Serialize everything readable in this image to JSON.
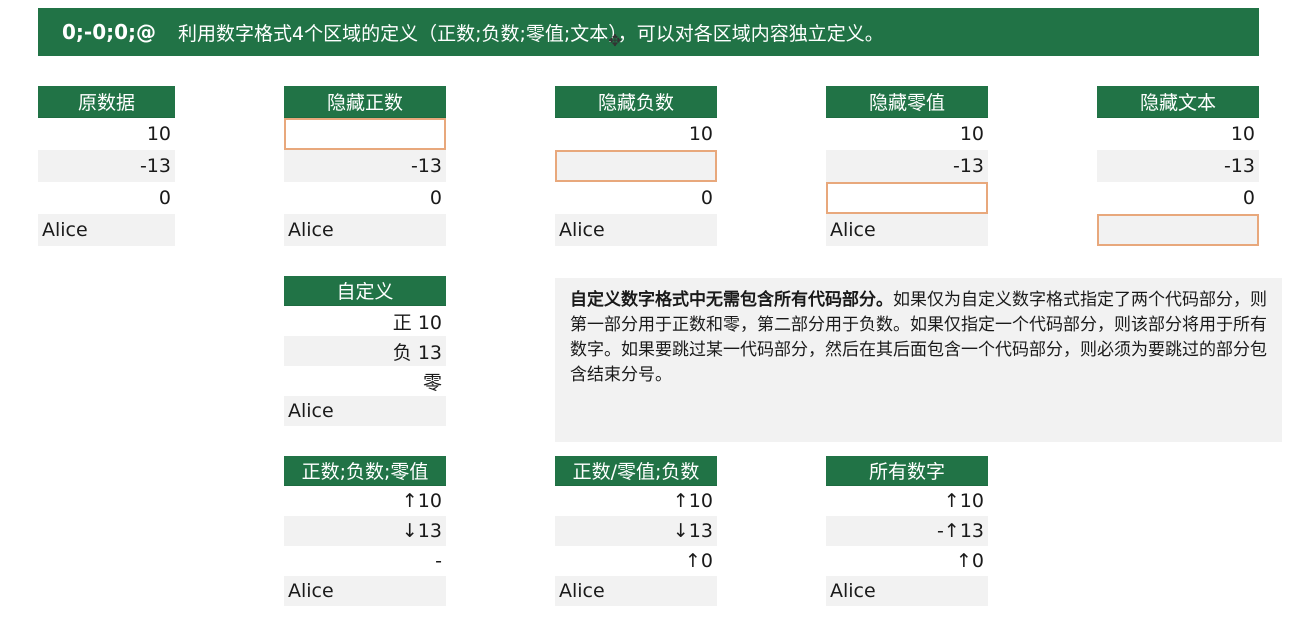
{
  "banner": {
    "code": "0;-0;0;@",
    "description": "利用数字格式4个区域的定义（正数;负数;零值;文本），可以对各区域内容独立定义。"
  },
  "tables": [
    {
      "header": "原数据",
      "rows": [
        "10",
        "-13",
        "0",
        "Alice"
      ]
    },
    {
      "header": "隐藏正数",
      "rows": [
        "",
        "-13",
        "0",
        "Alice"
      ]
    },
    {
      "header": "隐藏负数",
      "rows": [
        "10",
        "",
        "0",
        "Alice"
      ]
    },
    {
      "header": "隐藏零值",
      "rows": [
        "10",
        "-13",
        "",
        "Alice"
      ]
    },
    {
      "header": "隐藏文本",
      "rows": [
        "10",
        "-13",
        "0",
        ""
      ]
    }
  ],
  "custom": {
    "header": "自定义",
    "rows": [
      "正 10",
      "负 13",
      "零",
      "Alice"
    ]
  },
  "note": {
    "bold": "自定义数字格式中无需包含所有代码部分。",
    "text": "如果仅为自定义数字格式指定了两个代码部分，则第一部分用于正数和零，第二部分用于负数。如果仅指定一个代码部分，则该部分将用于所有数字。如果要跳过某一代码部分，然后在其后面包含一个代码部分，则必须为要跳过的部分包含结束分号。"
  },
  "bottom_tables": [
    {
      "header": "正数;负数;零值",
      "rows": [
        "↑10",
        "↓13",
        "-",
        "Alice"
      ]
    },
    {
      "header": "正数/零值;负数",
      "rows": [
        "↑10",
        "↓13",
        "↑0",
        "Alice"
      ]
    },
    {
      "header": "所有数字",
      "rows": [
        "↑10",
        "-↑13",
        "↑0",
        "Alice"
      ]
    }
  ]
}
